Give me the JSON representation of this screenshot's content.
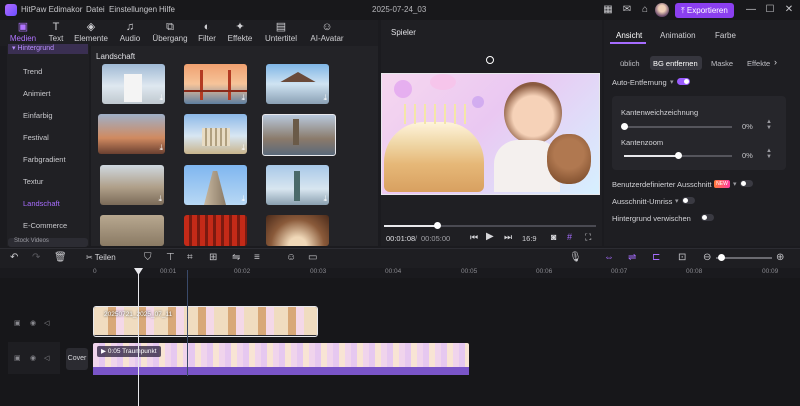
{
  "app": {
    "title": "HitPaw Edimakor",
    "menu": [
      "Datei",
      "Einstellungen",
      "Hilfe"
    ],
    "doc_title": "2025-07-24_03",
    "export_label": "Exportieren",
    "accent": "#8b3ff0"
  },
  "toolbar": {
    "items": [
      "Medien",
      "Text",
      "Elemente",
      "Audio",
      "Übergang",
      "Filter",
      "Effekte",
      "Untertitel",
      "AI-Avatar"
    ],
    "active": "Medien"
  },
  "sidebar": {
    "header": "Hintergrund",
    "items": [
      "Trend",
      "Animiert",
      "Einfarbig",
      "Festival",
      "Farbgradient",
      "Textur",
      "Landschaft",
      "E-Commerce"
    ],
    "active": "Landschaft",
    "footer": "Stock Videos"
  },
  "media": {
    "section": "Landschaft",
    "thumbs": [
      "temple-white",
      "golden-gate-bridge",
      "asian-temple-pier",
      "castle-sunset",
      "acropolis",
      "westminster-palace",
      "rome-ruins",
      "flatiron-building",
      "statue-of-liberty",
      "colosseum",
      "red-torii-gates",
      "arch-tunnel"
    ]
  },
  "player": {
    "label": "Spieler",
    "current_time": "00:01:08",
    "total_time": "00:05:00",
    "ratio": "16:9",
    "progress": 0.25
  },
  "right_panel": {
    "tabs": [
      "Ansicht",
      "Animation",
      "Farbe"
    ],
    "active_tab": "Ansicht",
    "subtabs": [
      "üblich",
      "BG entfernen",
      "Maske",
      "Effekte"
    ],
    "active_subtab": "BG entfernen",
    "auto_remove": {
      "label": "Auto-Entfernung",
      "on": true
    },
    "edge_blur": {
      "label": "Kantenweichzeichnung",
      "value": "0%",
      "level": 0
    },
    "edge_zoom": {
      "label": "Kantenzoom",
      "value": "0%",
      "level": 0.5
    },
    "custom_cutout": {
      "label": "Benutzerdefinierter Ausschnitt",
      "badge": "NEW",
      "on": false
    },
    "cutout_outline": {
      "label": "Ausschnitt-Umriss",
      "on": false
    },
    "bg_blur": {
      "label": "Hintergrund verwischen",
      "on": false
    }
  },
  "timeline": {
    "split_label": "Teilen",
    "ticks": [
      "0",
      "00:01",
      "00:02",
      "00:03",
      "00:04",
      "00:05",
      "00:06",
      "00:07",
      "00:08",
      "00:09"
    ],
    "cover_label": "Cover",
    "clip1": {
      "name": "20250721_2025_07_11"
    },
    "clip2": {
      "name": "0:05 Traumpunkt"
    },
    "playhead_time": "00:01"
  }
}
